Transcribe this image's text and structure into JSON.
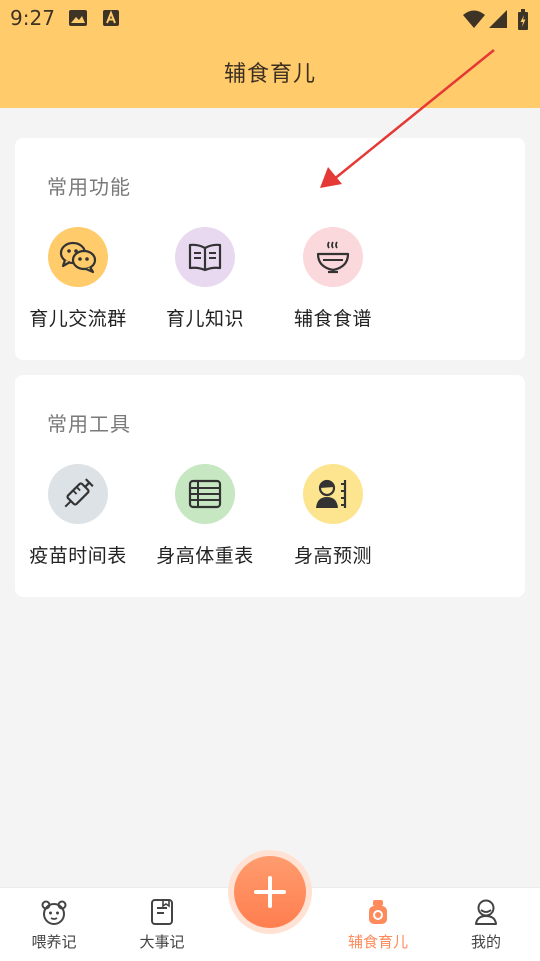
{
  "status": {
    "time": "9:27"
  },
  "header": {
    "title": "辅食育儿"
  },
  "sections": [
    {
      "title": "常用功能",
      "items": [
        {
          "label": "育儿交流群",
          "icon": "chat-bubbles-icon",
          "color": "#ffcb6b"
        },
        {
          "label": "育儿知识",
          "icon": "book-icon",
          "color": "#e9d9f0"
        },
        {
          "label": "辅食食谱",
          "icon": "food-bowl-icon",
          "color": "#fbd8dc"
        }
      ]
    },
    {
      "title": "常用工具",
      "items": [
        {
          "label": "疫苗时间表",
          "icon": "syringe-icon",
          "color": "#dde2e6"
        },
        {
          "label": "身高体重表",
          "icon": "table-icon",
          "color": "#c7e6c2"
        },
        {
          "label": "身高预测",
          "icon": "height-predict-icon",
          "color": "#fde58f"
        }
      ]
    }
  ],
  "tabbar": {
    "items": [
      {
        "label": "喂养记",
        "icon": "baby-face-icon"
      },
      {
        "label": "大事记",
        "icon": "notebook-icon"
      },
      {
        "label": "辅食育儿",
        "icon": "baby-bottle-icon",
        "active": true
      },
      {
        "label": "我的",
        "icon": "profile-icon"
      }
    ],
    "fab_icon": "plus-icon",
    "active_color": "#ff8a5b"
  },
  "colors": {
    "header": "#ffcb6b",
    "accent": "#ff7e4f",
    "annotation_arrow": "#e53935"
  }
}
